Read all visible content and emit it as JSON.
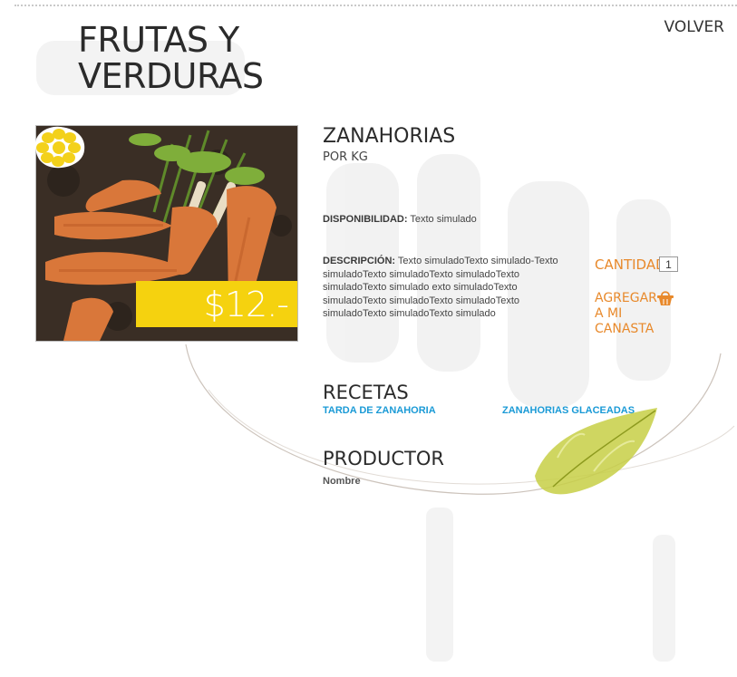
{
  "header": {
    "title_line1": "FRUTAS Y",
    "title_line2": "VERDURAS",
    "back_label": "VOLVER"
  },
  "product": {
    "name": "ZANAHORIAS",
    "unit": "POR KG",
    "price": "$12.-",
    "availability_label": "DISPONIBILIDAD:",
    "availability_value": "Texto simulado",
    "description_label": "DESCRIPCIÓN:",
    "description_text": "Texto simuladoTexto simulado-Texto simuladoTexto simuladoTexto simuladoTexto simuladoTexto simulado exto simuladoTexto simuladoTexto simuladoTexto simuladoTexto simuladoTexto simuladoTexto simulado"
  },
  "purchase": {
    "quantity_label": "CANTIDAD",
    "quantity_value": "1",
    "add_line1": "AGREGAR",
    "add_line2": "A MI CANASTA"
  },
  "recipes": {
    "heading": "RECETAS",
    "items": [
      "TARDA DE ZANAHORIA",
      "ZANAHORIAS GLACEADAS"
    ]
  },
  "producer": {
    "heading": "PRODUCTOR",
    "name": "Nombre"
  },
  "colors": {
    "accent_orange": "#e8892b",
    "price_yellow": "#f5d20f",
    "link_blue": "#1a9ad6"
  },
  "icons": {
    "flower": "flower-icon",
    "basket": "basket-icon",
    "leaf": "leaf-decoration"
  }
}
